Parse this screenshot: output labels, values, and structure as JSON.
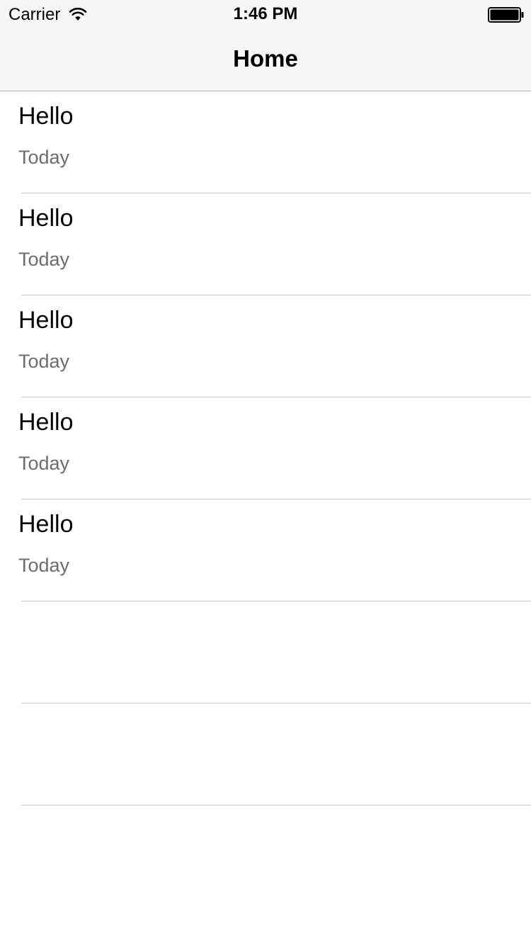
{
  "status_bar": {
    "carrier": "Carrier",
    "time": "1:46 PM",
    "wifi_icon": "wifi-icon",
    "battery_icon": "battery-icon"
  },
  "nav": {
    "title": "Home"
  },
  "list": {
    "items": [
      {
        "title": "Hello",
        "subtitle": "Today"
      },
      {
        "title": "Hello",
        "subtitle": "Today"
      },
      {
        "title": "Hello",
        "subtitle": "Today"
      },
      {
        "title": "Hello",
        "subtitle": "Today"
      },
      {
        "title": "Hello",
        "subtitle": "Today"
      }
    ]
  },
  "colors": {
    "nav_background": "#f7f7f7",
    "separator": "#c8c7cc",
    "subtitle_text": "#6d6d6d"
  }
}
